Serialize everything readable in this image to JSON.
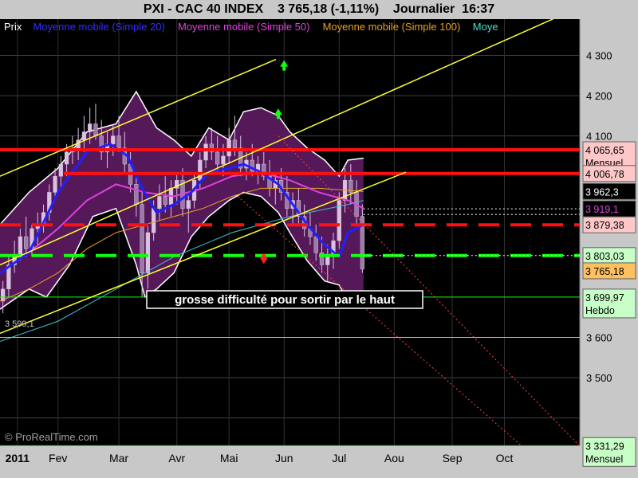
{
  "header": {
    "title": "PXI - CAC 40 INDEX    3 765,18 (-1,11%)    Journalier  16:37"
  },
  "legend": [
    {
      "label": "Prix",
      "color": "#ffffff"
    },
    {
      "label": "Moyenne mobile (Simple 20)",
      "color": "#3030ff"
    },
    {
      "label": "Moyenne mobile (Simple 50)",
      "color": "#e040e0"
    },
    {
      "label": "Moyenne mobile (Simple 100)",
      "color": "#e8a020"
    },
    {
      "label": "Moye",
      "color": "#40e0d0"
    }
  ],
  "annotation": "grosse difficulté pour sortir par le haut",
  "watermark": "© ProRealTime.com",
  "left_value": "3 599,1",
  "colors": {
    "background": "#000000",
    "band_fill": "#5a1a5e",
    "candle": "#d9c2e0",
    "ma20": "#2020ff",
    "ma50": "#e040e0",
    "ma100": "#e8a020",
    "ma200": "#40c0d0",
    "channel": "#ffff30",
    "resistance": "#ff1010",
    "support": "#10ff10",
    "axis_bg": "#c8c8c8"
  },
  "chart_data": {
    "type": "candlestick",
    "title": "PXI - CAC 40 INDEX",
    "ylim": [
      3330,
      4390
    ],
    "y_ticks": [
      {
        "value": 4300,
        "label": "4 300"
      },
      {
        "value": 4200,
        "label": "4 200"
      },
      {
        "value": 4100,
        "label": "4 100"
      },
      {
        "value": 3600,
        "label": "3 600"
      },
      {
        "value": 3500,
        "label": "3 500"
      }
    ],
    "x_ticks": [
      {
        "label": "2011",
        "bold": true,
        "t": 0.03
      },
      {
        "label": "Fev",
        "t": 0.1
      },
      {
        "label": "Mar",
        "t": 0.205
      },
      {
        "label": "Avr",
        "t": 0.305
      },
      {
        "label": "Mai",
        "t": 0.395
      },
      {
        "label": "Jun",
        "t": 0.49
      },
      {
        "label": "Jul",
        "t": 0.585
      },
      {
        "label": "Aou",
        "t": 0.68
      },
      {
        "label": "Sep",
        "t": 0.78
      },
      {
        "label": "Oct",
        "t": 0.87
      }
    ],
    "price_labels": [
      {
        "value": 4065.65,
        "label": "4 065,65",
        "sub": "Mensuel",
        "bg": "#ffc8c8",
        "fg": "#000000"
      },
      {
        "value": 4006.78,
        "label": "4 006,78",
        "bg": "#ffc8c8",
        "fg": "#000000"
      },
      {
        "value": 3962.3,
        "label": "3 962,3",
        "bg": "#000000",
        "fg": "#ffffff"
      },
      {
        "value": 3919.1,
        "label": "3 919,1",
        "bg": "#000000",
        "fg": "#e040e0"
      },
      {
        "value": 3879.38,
        "label": "3 879,38",
        "bg": "#ffc8c8",
        "fg": "#000000"
      },
      {
        "value": 3803.03,
        "label": "3 803,03",
        "bg": "#c8ffc8",
        "fg": "#000000"
      },
      {
        "value": 3765.18,
        "label": "3 765,18",
        "bg": "#ffc060",
        "fg": "#000000"
      },
      {
        "value": 3699.97,
        "label": "3 699,97",
        "sub": "Hebdo",
        "bg": "#c8ffc8",
        "fg": "#000000"
      },
      {
        "value": 3331.29,
        "label": "3 331,29",
        "sub": "Mensuel",
        "bg": "#c8ffc8",
        "fg": "#000000"
      }
    ],
    "candles": [
      {
        "t": 0.005,
        "o": 3690,
        "h": 3740,
        "l": 3660,
        "c": 3720
      },
      {
        "t": 0.015,
        "o": 3720,
        "h": 3800,
        "l": 3700,
        "c": 3780
      },
      {
        "t": 0.025,
        "o": 3780,
        "h": 3840,
        "l": 3760,
        "c": 3800
      },
      {
        "t": 0.035,
        "o": 3800,
        "h": 3870,
        "l": 3790,
        "c": 3850
      },
      {
        "t": 0.045,
        "o": 3850,
        "h": 3900,
        "l": 3800,
        "c": 3820
      },
      {
        "t": 0.055,
        "o": 3820,
        "h": 3880,
        "l": 3800,
        "c": 3870
      },
      {
        "t": 0.065,
        "o": 3870,
        "h": 3910,
        "l": 3830,
        "c": 3880
      },
      {
        "t": 0.075,
        "o": 3880,
        "h": 3930,
        "l": 3860,
        "c": 3910
      },
      {
        "t": 0.085,
        "o": 3910,
        "h": 3980,
        "l": 3890,
        "c": 3960
      },
      {
        "t": 0.095,
        "o": 3960,
        "h": 4020,
        "l": 3940,
        "c": 4000
      },
      {
        "t": 0.105,
        "o": 4000,
        "h": 4050,
        "l": 3970,
        "c": 4030
      },
      {
        "t": 0.115,
        "o": 4030,
        "h": 4080,
        "l": 4000,
        "c": 4060
      },
      {
        "t": 0.125,
        "o": 4060,
        "h": 4100,
        "l": 4030,
        "c": 4070
      },
      {
        "t": 0.135,
        "o": 4070,
        "h": 4120,
        "l": 4040,
        "c": 4090
      },
      {
        "t": 0.145,
        "o": 4090,
        "h": 4150,
        "l": 4060,
        "c": 4110
      },
      {
        "t": 0.155,
        "o": 4110,
        "h": 4170,
        "l": 4080,
        "c": 4130
      },
      {
        "t": 0.165,
        "o": 4130,
        "h": 4180,
        "l": 4090,
        "c": 4100
      },
      {
        "t": 0.175,
        "o": 4100,
        "h": 4140,
        "l": 4040,
        "c": 4060
      },
      {
        "t": 0.185,
        "o": 4060,
        "h": 4110,
        "l": 4020,
        "c": 4080
      },
      {
        "t": 0.195,
        "o": 4080,
        "h": 4130,
        "l": 4050,
        "c": 4100
      },
      {
        "t": 0.205,
        "o": 4100,
        "h": 4150,
        "l": 4060,
        "c": 4070
      },
      {
        "t": 0.215,
        "o": 4070,
        "h": 4110,
        "l": 4010,
        "c": 4030
      },
      {
        "t": 0.225,
        "o": 4030,
        "h": 4060,
        "l": 3960,
        "c": 3980
      },
      {
        "t": 0.235,
        "o": 3980,
        "h": 4010,
        "l": 3900,
        "c": 3930
      },
      {
        "t": 0.245,
        "o": 3930,
        "h": 3960,
        "l": 3700,
        "c": 3760
      },
      {
        "t": 0.255,
        "o": 3760,
        "h": 3880,
        "l": 3720,
        "c": 3860
      },
      {
        "t": 0.265,
        "o": 3860,
        "h": 3940,
        "l": 3840,
        "c": 3920
      },
      {
        "t": 0.275,
        "o": 3920,
        "h": 3980,
        "l": 3890,
        "c": 3950
      },
      {
        "t": 0.285,
        "o": 3950,
        "h": 4000,
        "l": 3910,
        "c": 3930
      },
      {
        "t": 0.295,
        "o": 3930,
        "h": 3990,
        "l": 3900,
        "c": 3970
      },
      {
        "t": 0.305,
        "o": 3970,
        "h": 4010,
        "l": 3930,
        "c": 3990
      },
      {
        "t": 0.315,
        "o": 3990,
        "h": 4020,
        "l": 3900,
        "c": 3920
      },
      {
        "t": 0.325,
        "o": 3920,
        "h": 3960,
        "l": 3860,
        "c": 3940
      },
      {
        "t": 0.335,
        "o": 3940,
        "h": 4010,
        "l": 3920,
        "c": 3990
      },
      {
        "t": 0.345,
        "o": 3990,
        "h": 4060,
        "l": 3970,
        "c": 4040
      },
      {
        "t": 0.355,
        "o": 4040,
        "h": 4100,
        "l": 4020,
        "c": 4080
      },
      {
        "t": 0.365,
        "o": 4080,
        "h": 4120,
        "l": 4040,
        "c": 4060
      },
      {
        "t": 0.375,
        "o": 4060,
        "h": 4100,
        "l": 4010,
        "c": 4030
      },
      {
        "t": 0.385,
        "o": 4030,
        "h": 4080,
        "l": 4000,
        "c": 4050
      },
      {
        "t": 0.395,
        "o": 4050,
        "h": 4120,
        "l": 4030,
        "c": 4090
      },
      {
        "t": 0.405,
        "o": 4090,
        "h": 4150,
        "l": 4050,
        "c": 4070
      },
      {
        "t": 0.415,
        "o": 4070,
        "h": 4100,
        "l": 4000,
        "c": 4020
      },
      {
        "t": 0.425,
        "o": 4020,
        "h": 4060,
        "l": 3990,
        "c": 4040
      },
      {
        "t": 0.435,
        "o": 4040,
        "h": 4080,
        "l": 4000,
        "c": 4010
      },
      {
        "t": 0.445,
        "o": 4010,
        "h": 4050,
        "l": 3980,
        "c": 4030
      },
      {
        "t": 0.455,
        "o": 4030,
        "h": 4060,
        "l": 3990,
        "c": 4000
      },
      {
        "t": 0.465,
        "o": 4000,
        "h": 4040,
        "l": 3950,
        "c": 3970
      },
      {
        "t": 0.475,
        "o": 3970,
        "h": 4010,
        "l": 3930,
        "c": 3990
      },
      {
        "t": 0.485,
        "o": 3990,
        "h": 4020,
        "l": 3940,
        "c": 3960
      },
      {
        "t": 0.495,
        "o": 3960,
        "h": 4000,
        "l": 3900,
        "c": 3920
      },
      {
        "t": 0.505,
        "o": 3920,
        "h": 3960,
        "l": 3880,
        "c": 3940
      },
      {
        "t": 0.515,
        "o": 3940,
        "h": 3970,
        "l": 3880,
        "c": 3900
      },
      {
        "t": 0.525,
        "o": 3900,
        "h": 3930,
        "l": 3850,
        "c": 3870
      },
      {
        "t": 0.535,
        "o": 3870,
        "h": 3910,
        "l": 3830,
        "c": 3850
      },
      {
        "t": 0.545,
        "o": 3850,
        "h": 3880,
        "l": 3790,
        "c": 3810
      },
      {
        "t": 0.555,
        "o": 3810,
        "h": 3850,
        "l": 3760,
        "c": 3780
      },
      {
        "t": 0.565,
        "o": 3780,
        "h": 3830,
        "l": 3740,
        "c": 3800
      },
      {
        "t": 0.575,
        "o": 3800,
        "h": 3860,
        "l": 3770,
        "c": 3840
      },
      {
        "t": 0.585,
        "o": 3840,
        "h": 3960,
        "l": 3820,
        "c": 3940
      },
      {
        "t": 0.595,
        "o": 3940,
        "h": 4020,
        "l": 3910,
        "c": 3990
      },
      {
        "t": 0.605,
        "o": 3990,
        "h": 4030,
        "l": 3930,
        "c": 3960
      },
      {
        "t": 0.615,
        "o": 3960,
        "h": 3990,
        "l": 3880,
        "c": 3900
      },
      {
        "t": 0.625,
        "o": 3900,
        "h": 3930,
        "l": 3760,
        "c": 3770
      }
    ],
    "band_upper": [
      [
        0.0,
        3880
      ],
      [
        0.05,
        3960
      ],
      [
        0.1,
        4020
      ],
      [
        0.15,
        4110
      ],
      [
        0.2,
        4130
      ],
      [
        0.235,
        4210
      ],
      [
        0.27,
        4120
      ],
      [
        0.3,
        4090
      ],
      [
        0.33,
        4050
      ],
      [
        0.36,
        4120
      ],
      [
        0.395,
        4090
      ],
      [
        0.42,
        4160
      ],
      [
        0.45,
        4170
      ],
      [
        0.48,
        4150
      ],
      [
        0.5,
        4110
      ],
      [
        0.53,
        4070
      ],
      [
        0.56,
        4040
      ],
      [
        0.585,
        4000
      ],
      [
        0.6,
        4040
      ],
      [
        0.627,
        4045
      ]
    ],
    "band_lower": [
      [
        0.0,
        3670
      ],
      [
        0.05,
        3720
      ],
      [
        0.08,
        3700
      ],
      [
        0.12,
        3780
      ],
      [
        0.16,
        3900
      ],
      [
        0.2,
        3920
      ],
      [
        0.235,
        3780
      ],
      [
        0.25,
        3700
      ],
      [
        0.27,
        3720
      ],
      [
        0.3,
        3760
      ],
      [
        0.33,
        3850
      ],
      [
        0.36,
        3900
      ],
      [
        0.395,
        3940
      ],
      [
        0.42,
        3960
      ],
      [
        0.45,
        3950
      ],
      [
        0.48,
        3910
      ],
      [
        0.5,
        3860
      ],
      [
        0.53,
        3790
      ],
      [
        0.56,
        3740
      ],
      [
        0.585,
        3730
      ],
      [
        0.6,
        3690
      ],
      [
        0.627,
        3700
      ]
    ],
    "ma20": [
      [
        0.0,
        3760
      ],
      [
        0.05,
        3810
      ],
      [
        0.1,
        3960
      ],
      [
        0.15,
        4060
      ],
      [
        0.19,
        4080
      ],
      [
        0.22,
        4050
      ],
      [
        0.245,
        3970
      ],
      [
        0.27,
        3910
      ],
      [
        0.3,
        3930
      ],
      [
        0.33,
        3960
      ],
      [
        0.36,
        4010
      ],
      [
        0.395,
        4020
      ],
      [
        0.42,
        4030
      ],
      [
        0.45,
        4010
      ],
      [
        0.48,
        3980
      ],
      [
        0.5,
        3940
      ],
      [
        0.53,
        3880
      ],
      [
        0.56,
        3830
      ],
      [
        0.585,
        3800
      ],
      [
        0.6,
        3860
      ],
      [
        0.627,
        3880
      ]
    ],
    "ma50": [
      [
        0.0,
        3760
      ],
      [
        0.05,
        3810
      ],
      [
        0.1,
        3870
      ],
      [
        0.15,
        3940
      ],
      [
        0.2,
        3980
      ],
      [
        0.25,
        3960
      ],
      [
        0.3,
        3950
      ],
      [
        0.35,
        3970
      ],
      [
        0.4,
        4000
      ],
      [
        0.45,
        4010
      ],
      [
        0.5,
        3990
      ],
      [
        0.55,
        3960
      ],
      [
        0.6,
        3940
      ],
      [
        0.627,
        3920
      ]
    ],
    "ma100": [
      [
        0.0,
        3690
      ],
      [
        0.05,
        3720
      ],
      [
        0.1,
        3760
      ],
      [
        0.15,
        3820
      ],
      [
        0.2,
        3860
      ],
      [
        0.25,
        3880
      ],
      [
        0.3,
        3900
      ],
      [
        0.35,
        3920
      ],
      [
        0.4,
        3950
      ],
      [
        0.45,
        3970
      ],
      [
        0.5,
        3970
      ],
      [
        0.55,
        3970
      ],
      [
        0.6,
        3965
      ],
      [
        0.627,
        3962
      ]
    ],
    "ma200": [
      [
        0.0,
        3590
      ],
      [
        0.1,
        3640
      ],
      [
        0.2,
        3720
      ],
      [
        0.3,
        3800
      ],
      [
        0.4,
        3860
      ],
      [
        0.5,
        3900
      ],
      [
        0.6,
        3930
      ],
      [
        0.627,
        3940
      ]
    ],
    "channel_upper": [
      [
        0.0,
        4000
      ],
      [
        0.476,
        4290
      ]
    ],
    "channel_middle": [
      [
        0.0,
        3780
      ],
      [
        1.0,
        4420
      ]
    ],
    "channel_lower": [
      [
        0.0,
        3610
      ],
      [
        0.7,
        4010
      ]
    ],
    "down_trend_1": [
      [
        0.48,
        4100
      ],
      [
        1.0,
        3330
      ]
    ],
    "down_trend_2": [
      [
        0.41,
        3950
      ],
      [
        0.9,
        3330
      ]
    ],
    "h_lines": [
      {
        "value": 4065.65,
        "style": "solid",
        "color": "#ff1010",
        "width": 4,
        "t0": 0.0
      },
      {
        "value": 4006.78,
        "style": "solid",
        "color": "#ff1010",
        "width": 4,
        "t0": 0.11
      },
      {
        "value": 3879.38,
        "style": "dash",
        "color": "#ff1010",
        "width": 4,
        "t0": 0.0
      },
      {
        "value": 3803.03,
        "style": "dash",
        "color": "#10ff10",
        "width": 4,
        "t0": 0.0
      },
      {
        "value": 3699.97,
        "style": "solid",
        "color": "#10ff10",
        "width": 1,
        "t0": 0.0
      },
      {
        "value": 3600,
        "style": "solid",
        "color": "#e0c040",
        "width": 1,
        "t0": 0.0
      },
      {
        "value": 3331.29,
        "style": "solid",
        "color": "#10ff10",
        "width": 1,
        "t0": 0.0
      },
      {
        "value": 3919.1,
        "style": "dot",
        "color": "#ffffff",
        "width": 1,
        "t0": 0.627
      },
      {
        "value": 3905,
        "style": "dot",
        "color": "#ffffff",
        "width": 1,
        "t0": 0.627
      },
      {
        "value": 3803.03,
        "style": "dot",
        "color": "#ffffff",
        "width": 1,
        "t0": 0.627
      }
    ],
    "arrows": [
      {
        "t": 0.49,
        "value": 4280,
        "dir": "up",
        "color": "#10ff10"
      },
      {
        "t": 0.48,
        "value": 4160,
        "dir": "up",
        "color": "#10ff10"
      },
      {
        "t": 0.455,
        "value": 3790,
        "dir": "down",
        "color": "#ff2020"
      }
    ]
  }
}
